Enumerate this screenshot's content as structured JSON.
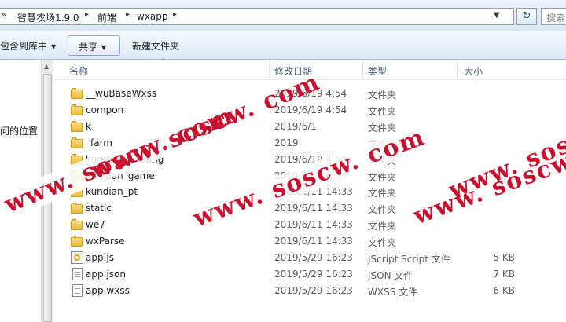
{
  "address_bar": {
    "crumbs": [
      "智慧农场1.9.0",
      "前端",
      "wxapp"
    ],
    "separator": "▸",
    "search_placeholder": "搜索"
  },
  "toolbar": {
    "include_label": "包含到库中",
    "share_label": "共享",
    "new_folder_label": "新建文件夹"
  },
  "nav_pane": {
    "location_text": "问的位置"
  },
  "columns": {
    "name": "名称",
    "date": "修改日期",
    "type": "类型",
    "size": "大小"
  },
  "files": [
    {
      "name": "__wuBaseWxss",
      "date": "2019/6/19 4:54",
      "type": "文件夹",
      "size": "",
      "icon": "folder-icon"
    },
    {
      "name": "compon",
      "date": "2019/6/19 4:54",
      "type": "文件夹",
      "size": "",
      "icon": "folder-icon"
    },
    {
      "name": "k",
      "date": "2019/6/1",
      "type": "文件夹",
      "size": "",
      "icon": "folder-icon"
    },
    {
      "name": "_farm",
      "date": "2019",
      "type": "文件夹",
      "size": "",
      "icon": "folder-icon"
    },
    {
      "name": "kundian_funding",
      "date": "2019/6/19 4:54",
      "type": "文件夹",
      "size": "",
      "icon": "folder-icon"
    },
    {
      "name": "kundian_game",
      "date": "2019/6/19 4:54",
      "type": "文件夹",
      "size": "",
      "icon": "folder-icon"
    },
    {
      "name": "kundian_pt",
      "date": "2019/6/11 14:33",
      "type": "文件夹",
      "size": "",
      "icon": "folder-icon"
    },
    {
      "name": "static",
      "date": "2019/6/11 14:33",
      "type": "文件夹",
      "size": "",
      "icon": "folder-icon"
    },
    {
      "name": "we7",
      "date": "2019/6/11 14:33",
      "type": "文件夹",
      "size": "",
      "icon": "folder-icon"
    },
    {
      "name": "wxParse",
      "date": "2019/6/11 14:33",
      "type": "文件夹",
      "size": "",
      "icon": "folder-icon"
    },
    {
      "name": "app.js",
      "date": "2019/5/29 16:23",
      "type": "JScript Script 文件",
      "size": "5 KB",
      "icon": "jscript-file-icon"
    },
    {
      "name": "app.json",
      "date": "2019/5/29 16:23",
      "type": "JSON 文件",
      "size": "7 KB",
      "icon": "document-icon"
    },
    {
      "name": "app.wxss",
      "date": "2019/5/29 16:23",
      "type": "WXSS 文件",
      "size": "6 KB",
      "icon": "document-icon"
    }
  ],
  "watermarks": [
    "www. soscw. com",
    "www. soscw. com",
    "www. soscw. com",
    "www. soscw. com",
    "www. soscw. c"
  ]
}
